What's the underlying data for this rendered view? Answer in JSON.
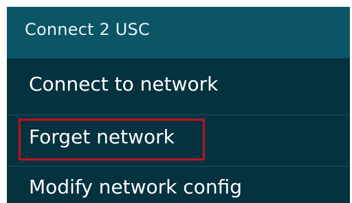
{
  "dialog": {
    "title": "Connect 2 USC",
    "items": [
      {
        "label": "Connect to network"
      },
      {
        "label": "Forget network",
        "highlighted": true
      },
      {
        "label": "Modify network config"
      }
    ]
  },
  "colors": {
    "header_bg": "#0b5566",
    "body_bg": "#05323f",
    "text": "#ffffff",
    "highlight": "#c0121c"
  }
}
